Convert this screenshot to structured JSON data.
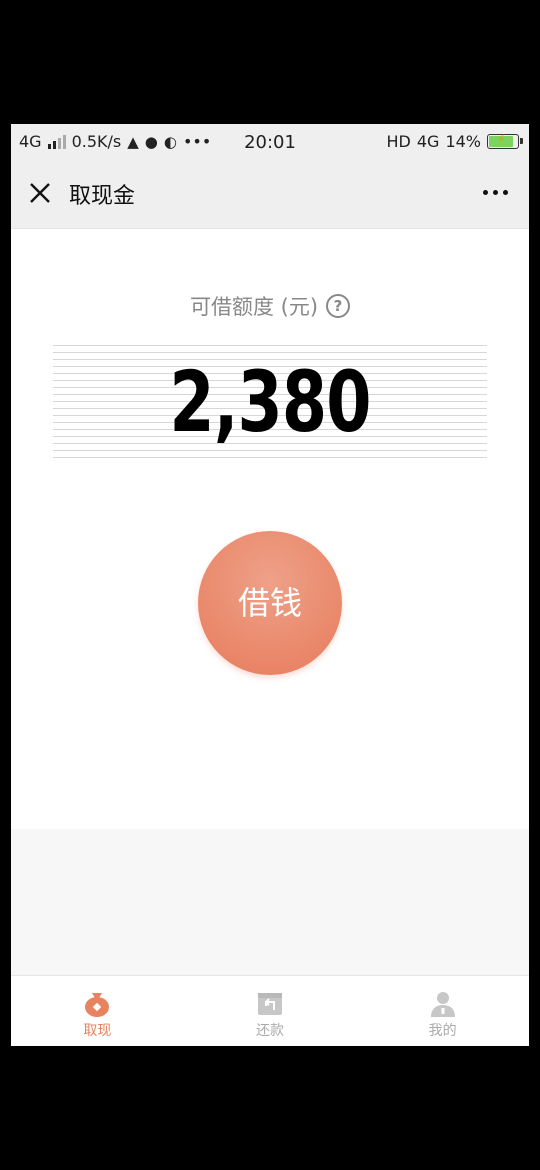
{
  "status_bar": {
    "network": "4G",
    "speed": "0.5K/s",
    "time": "20:01",
    "hd": "HD",
    "network_right": "4G",
    "battery": "14%",
    "dots": "•••"
  },
  "header": {
    "title": "取现金"
  },
  "quota": {
    "label": "可借额度 (元)",
    "help_glyph": "?",
    "amount": "2,380"
  },
  "borrow_button": {
    "label": "借钱"
  },
  "tabs": [
    {
      "label": "取现",
      "icon": "money-bag-icon",
      "active": true
    },
    {
      "label": "还款",
      "icon": "repay-box-icon",
      "active": false
    },
    {
      "label": "我的",
      "icon": "user-icon",
      "active": false
    }
  ],
  "colors": {
    "accent": "#e8835f",
    "inactive": "#c7c7c7"
  }
}
